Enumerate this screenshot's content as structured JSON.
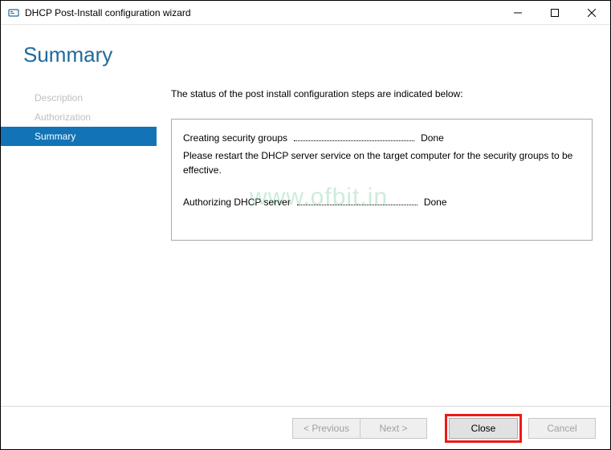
{
  "window": {
    "title": "DHCP Post-Install configuration wizard"
  },
  "header": {
    "title": "Summary"
  },
  "sidebar": {
    "items": [
      {
        "label": "Description"
      },
      {
        "label": "Authorization"
      },
      {
        "label": "Summary"
      }
    ]
  },
  "content": {
    "intro": "The status of the post install configuration steps are indicated below:",
    "step1_label": "Creating security groups",
    "step1_result": "Done",
    "step1_note": "Please restart the DHCP server service on the target computer for the security groups to be effective.",
    "step2_label": "Authorizing DHCP server",
    "step2_result": "Done"
  },
  "footer": {
    "previous": "< Previous",
    "next": "Next >",
    "close": "Close",
    "cancel": "Cancel"
  },
  "watermark": "www.ofbit.in"
}
